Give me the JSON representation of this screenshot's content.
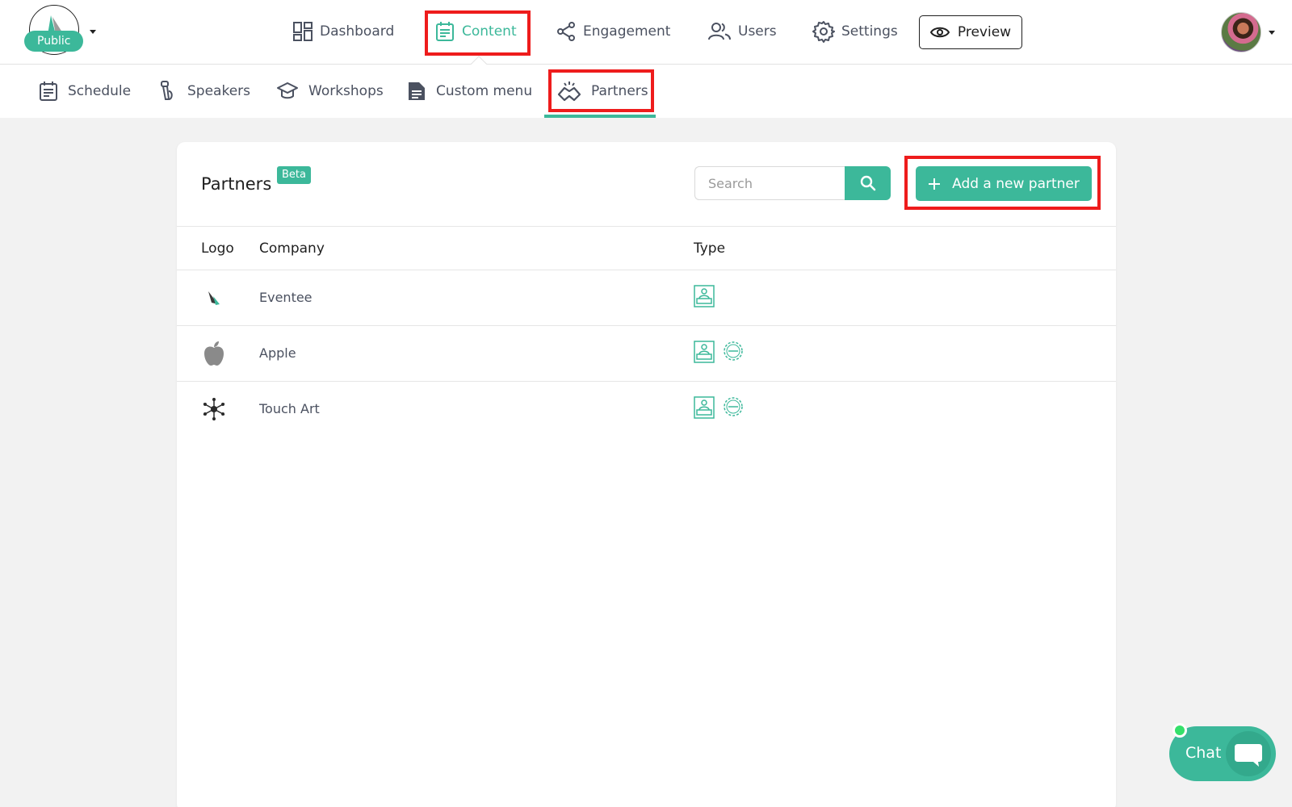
{
  "app": {
    "status_badge": "Public"
  },
  "topnav": {
    "items": [
      {
        "label": "Dashboard",
        "icon": "dashboard-icon"
      },
      {
        "label": "Content",
        "icon": "calendar-icon",
        "active": true
      },
      {
        "label": "Engagement",
        "icon": "share-icon"
      },
      {
        "label": "Users",
        "icon": "users-icon"
      },
      {
        "label": "Settings",
        "icon": "gear-icon"
      }
    ],
    "preview_label": "Preview",
    "accent_color": "#3cb89a"
  },
  "subnav": {
    "items": [
      {
        "label": "Schedule",
        "icon": "calendar-icon"
      },
      {
        "label": "Speakers",
        "icon": "microphone-icon"
      },
      {
        "label": "Workshops",
        "icon": "graduation-cap-icon"
      },
      {
        "label": "Custom menu",
        "icon": "document-icon"
      },
      {
        "label": "Partners",
        "icon": "handshake-icon",
        "active": true
      }
    ]
  },
  "partners": {
    "title": "Partners",
    "badge": "Beta",
    "search_placeholder": "Search",
    "add_button": "Add a new partner",
    "columns": [
      "Logo",
      "Company",
      "Type"
    ],
    "rows": [
      {
        "company": "Eventee",
        "logo": "eventee-logo",
        "types": [
          "exhibitor"
        ]
      },
      {
        "company": "Apple",
        "logo": "apple-logo",
        "types": [
          "exhibitor",
          "sponsor"
        ]
      },
      {
        "company": "Touch Art",
        "logo": "touch-art-logo",
        "types": [
          "exhibitor",
          "sponsor"
        ]
      }
    ]
  },
  "chat": {
    "label": "Chat",
    "online_color": "#35e06b"
  }
}
